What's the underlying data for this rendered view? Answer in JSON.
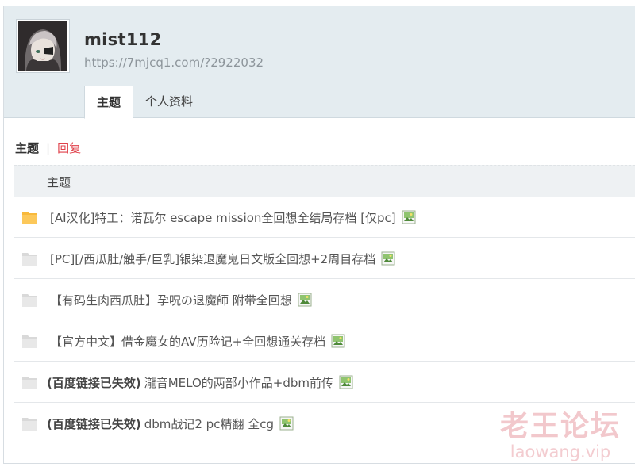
{
  "profile": {
    "username": "mist112",
    "url": "https://7mjcq1.com/?2922032",
    "avatar_icon": "avatar-portrait"
  },
  "tabs": [
    {
      "label": "主题",
      "active": true
    },
    {
      "label": "个人资料",
      "active": false
    }
  ],
  "subnav": {
    "active_label": "主题",
    "separator": "|",
    "reply_label": "回复"
  },
  "table": {
    "header": "主题",
    "rows": [
      {
        "status": "",
        "title": "[AI汉化]特工：诺瓦尔 escape mission全回想全结局存档 [仅pc]",
        "icon": "folder-hot-icon",
        "has_image": true
      },
      {
        "status": "",
        "title": "[PC][/西瓜肚/触手/巨乳]银染退魔鬼日文版全回想+2周目存档",
        "icon": "folder-icon",
        "has_image": true
      },
      {
        "status": "",
        "title": "【有码生肉西瓜肚】孕呪の退魔師 附带全回想",
        "icon": "folder-icon",
        "has_image": true
      },
      {
        "status": "",
        "title": "【官方中文】借金魔女的AV历险记+全回想通关存档",
        "icon": "folder-icon",
        "has_image": true
      },
      {
        "status": "(百度链接已失效)",
        "title": "瀧音MELO的两部小作品+dbm前传",
        "icon": "folder-icon",
        "has_image": true
      },
      {
        "status": "(百度链接已失效)",
        "title": "dbm战记2 pc精翻 全cg",
        "icon": "folder-icon",
        "has_image": true
      }
    ]
  },
  "watermark": {
    "cn": "老王论坛",
    "en": "laowang.vip"
  },
  "colors": {
    "header_bg": "#e4ecf0",
    "reply_link": "#e0424b",
    "hot_folder": "#f8b93c",
    "folder": "#e3e3e3"
  }
}
